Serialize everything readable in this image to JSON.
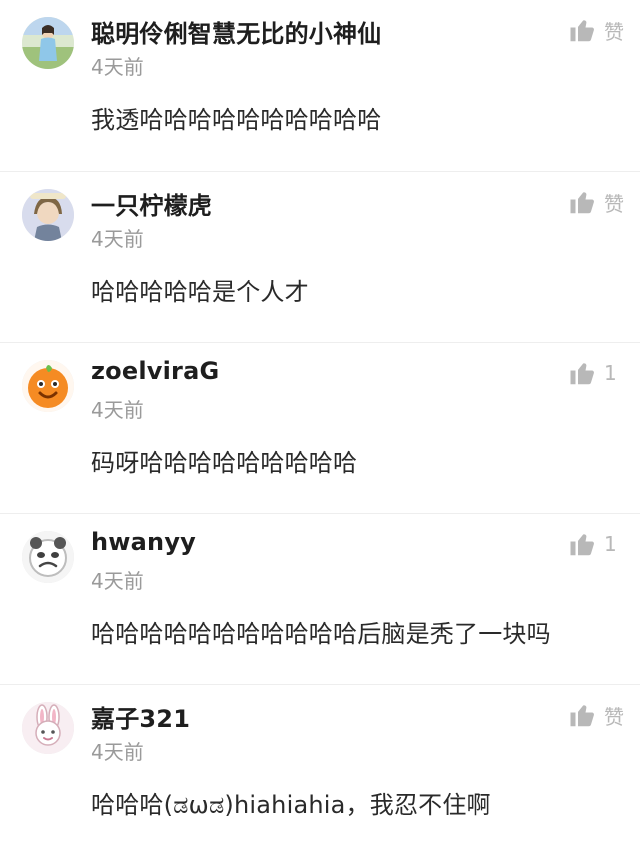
{
  "comments": [
    {
      "user": "聪明伶俐智慧无比的小神仙",
      "time": "4天前",
      "text": "我透哈哈哈哈哈哈哈哈哈哈",
      "likes": "赞",
      "avatar_icon": "girl-in-field-avatar-icon"
    },
    {
      "user": "一只柠檬虎",
      "time": "4天前",
      "text": "哈哈哈哈哈是个人才",
      "likes": "赞",
      "avatar_icon": "cartoon-girl-avatar-icon"
    },
    {
      "user": "zoelviraG",
      "time": "4天前",
      "text": "码呀哈哈哈哈哈哈哈哈哈",
      "likes": "1",
      "avatar_icon": "orange-mascot-avatar-icon"
    },
    {
      "user": "hwanyy",
      "time": "4天前",
      "text": "哈哈哈哈哈哈哈哈哈哈哈后脑是秃了一块吗",
      "likes": "1",
      "avatar_icon": "panda-meme-avatar-icon"
    },
    {
      "user": "嘉子321",
      "time": "4天前",
      "text": "哈哈哈(ಡωಡ)hiahiahia，我忍不住啊",
      "likes": "赞",
      "avatar_icon": "bunny-avatar-icon"
    }
  ],
  "colors": {
    "username": "#1e1e1e",
    "meta": "#9a9a9a",
    "like_icon": "#b8b8b8",
    "divider": "#eeeeee"
  }
}
